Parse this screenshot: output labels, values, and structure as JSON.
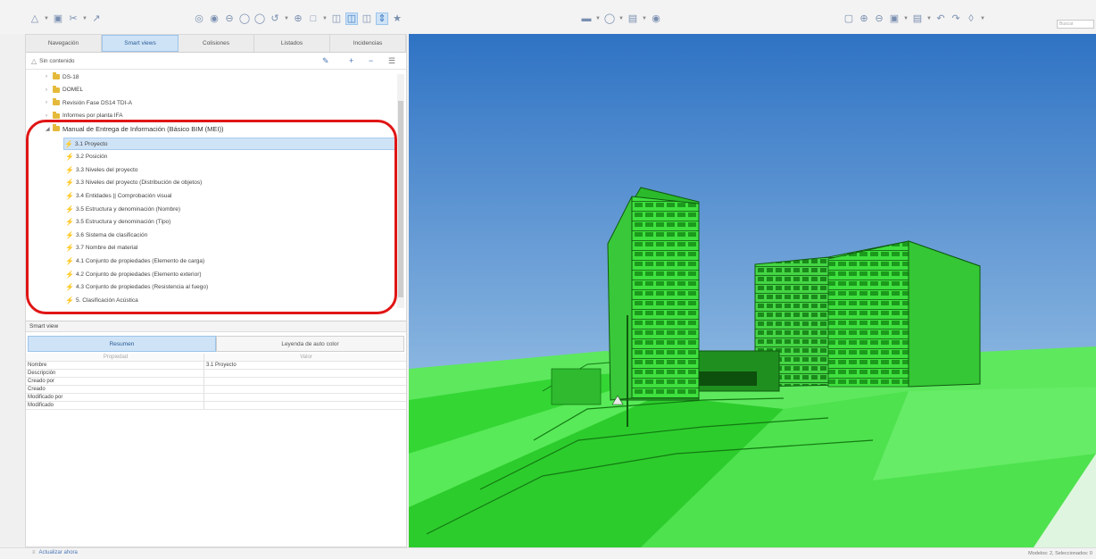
{
  "toolbar": {
    "left_icons": [
      "select-icon",
      "save-icon",
      "cut-icon",
      "link-icon"
    ],
    "center_icons": [
      "orbit-icon",
      "look-icon",
      "walk-icon",
      "zoom-icon",
      "pan-icon",
      "undo-view-icon",
      "measure-icon",
      "section-box-icon",
      "section-plane-icon",
      "transparency-icon",
      "clip-icon",
      "navigate-icon",
      "markup-icon"
    ],
    "view_icons": [
      "display-style-icon",
      "visibility-icon",
      "filter-icon",
      "camera-icon"
    ],
    "right_icons": [
      "fit-icon",
      "zoom-in-icon",
      "zoom-out-icon",
      "viewpoints-icon",
      "layout-icon",
      "undo-icon",
      "redo-icon",
      "tools-icon"
    ],
    "search_placeholder": "Buscar"
  },
  "main_tabs": [
    {
      "label": "Navegación",
      "active": false
    },
    {
      "label": "Smart views",
      "active": true
    },
    {
      "label": "Colisiones",
      "active": false
    },
    {
      "label": "Listados",
      "active": false
    },
    {
      "label": "Incidencias",
      "active": false
    }
  ],
  "smart_views": {
    "new_folder_label": "Sin contenido",
    "action_icons": [
      "edit-icon",
      "add-icon",
      "remove-icon",
      "menu-icon"
    ],
    "tree": [
      {
        "label": "DS-18",
        "level": 0,
        "type": "folder",
        "expanded": false
      },
      {
        "label": "DOMEL",
        "level": 0,
        "type": "folder",
        "expanded": false
      },
      {
        "label": "Revisión Fase DS14 TDI-A",
        "level": 0,
        "type": "folder",
        "expanded": false
      },
      {
        "label": "Informes por planta IFA",
        "level": 0,
        "type": "folder",
        "expanded": false
      },
      {
        "label": "Manual de Entrega de Información (Básico BIM (MEI))",
        "level": 0,
        "type": "folder",
        "expanded": true
      },
      {
        "label": "3.1 Proyecto",
        "level": 1,
        "type": "view",
        "selected": true
      },
      {
        "label": "3.2 Posición",
        "level": 1,
        "type": "view"
      },
      {
        "label": "3.3 Niveles del proyecto",
        "level": 1,
        "type": "view"
      },
      {
        "label": "3.3 Niveles del proyecto (Distribución de objetos)",
        "level": 1,
        "type": "view"
      },
      {
        "label": "3.4 Entidades || Comprobación visual",
        "level": 1,
        "type": "view"
      },
      {
        "label": "3.5 Estructura y denominación (Nombre)",
        "level": 1,
        "type": "view"
      },
      {
        "label": "3.5 Estructura y denominación (Tipo)",
        "level": 1,
        "type": "view"
      },
      {
        "label": "3.6 Sistema de clasificación",
        "level": 1,
        "type": "view"
      },
      {
        "label": "3.7 Nombre del material",
        "level": 1,
        "type": "view"
      },
      {
        "label": "4.1 Conjunto de propiedades (Elemento de carga)",
        "level": 1,
        "type": "view"
      },
      {
        "label": "4.2 Conjunto de propiedades (Elemento exterior)",
        "level": 1,
        "type": "view"
      },
      {
        "label": "4.3 Conjunto de propiedades (Resistencia al fuego)",
        "level": 1,
        "type": "view"
      },
      {
        "label": "5. Clasificación Acústica",
        "level": 1,
        "type": "view"
      }
    ]
  },
  "properties": {
    "header": "Smart view",
    "tabs": [
      {
        "label": "Resumen",
        "active": true
      },
      {
        "label": "Leyenda de auto color",
        "active": false
      }
    ],
    "columns": [
      "Propiedad",
      "Valor"
    ],
    "rows": [
      {
        "key": "Nombre",
        "value": "3.1 Proyecto"
      },
      {
        "key": "Descripción",
        "value": ""
      },
      {
        "key": "Creado por",
        "value": ""
      },
      {
        "key": "Creado",
        "value": ""
      },
      {
        "key": "Modificado por",
        "value": ""
      },
      {
        "key": "Modificado",
        "value": ""
      }
    ]
  },
  "viewport": {
    "sky_top": "#2f73c4",
    "sky_bottom": "#b9d8ef",
    "model_color": "#3fe03f",
    "model_dark": "#1c7a1c"
  },
  "highlight_color": "#e01515",
  "status": {
    "left": "Actualizar ahora",
    "right": "Modelos: 2, Seleccionados: 0"
  }
}
